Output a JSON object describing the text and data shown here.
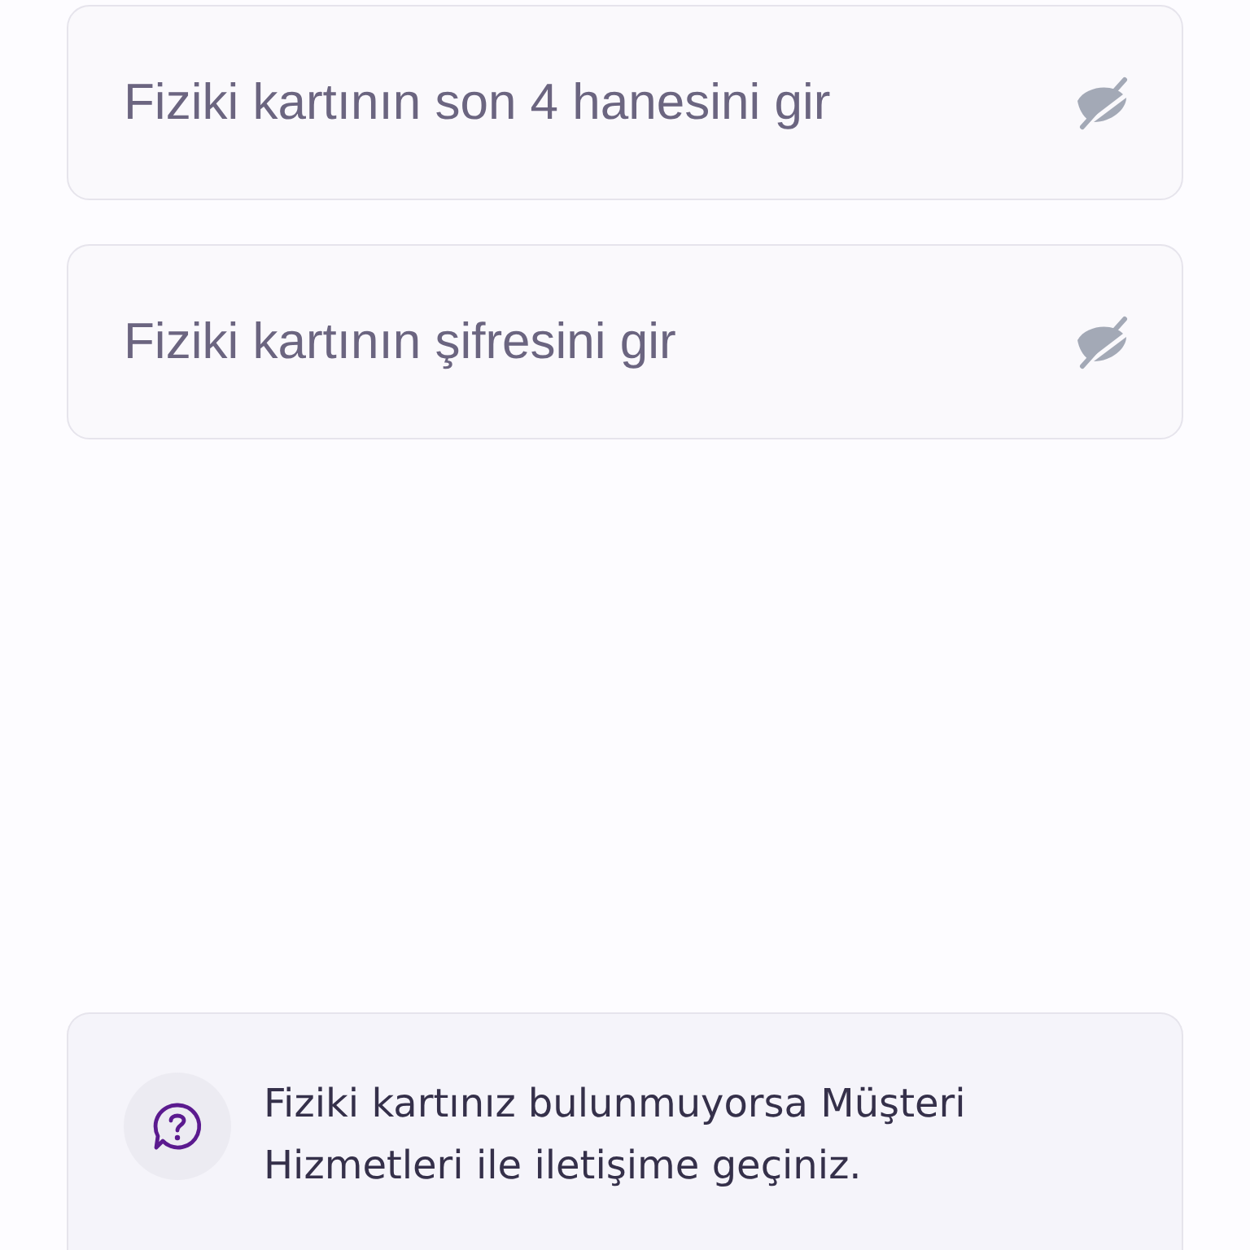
{
  "fields": [
    {
      "placeholder": "Fiziki kartının son 4 hanesini gir",
      "hidden": true
    },
    {
      "placeholder": "Fiziki kartının şifresini gir",
      "hidden": true
    }
  ],
  "info": {
    "text": "Fiziki kartınız bulunmuyorsa Müşteri Hizmetleri ile iletişime geçiniz."
  }
}
